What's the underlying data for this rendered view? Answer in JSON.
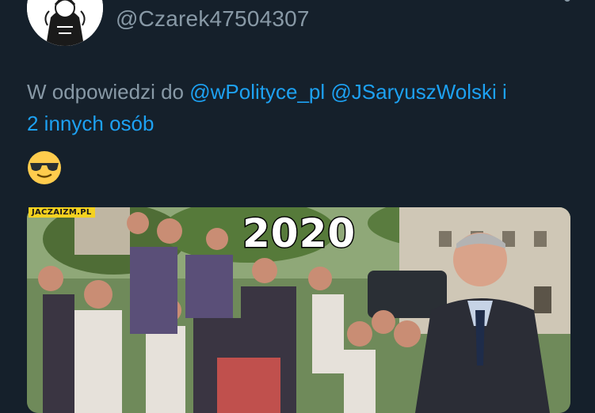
{
  "tweet": {
    "author_handle": "@Czarek47504307",
    "reply_prefix": "W odpowiedzi do",
    "mentions": [
      "@wPolityce_pl",
      "@JSaryuszWolski"
    ],
    "reply_and": "i",
    "others": "2 innych osób",
    "emoji": "sunglasses-face",
    "media": {
      "overlay_text": "2020",
      "watermark": "JACZAIZM.PL"
    }
  },
  "colors": {
    "background": "#15202b",
    "secondary_text": "#8899a6",
    "link": "#1da1f2"
  }
}
